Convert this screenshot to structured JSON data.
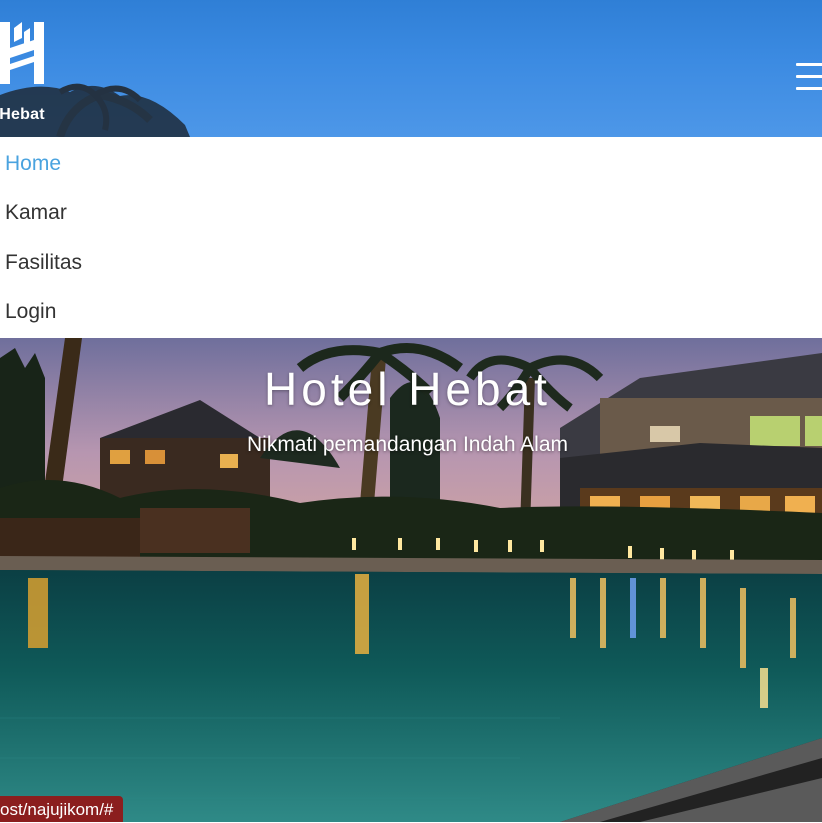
{
  "header": {
    "logo_text": "l Hebat",
    "logo_icon": "building-h-logo",
    "menu_icon": "hamburger-menu-icon"
  },
  "nav": {
    "items": [
      {
        "label": "Home",
        "active": true
      },
      {
        "label": "Kamar",
        "active": false
      },
      {
        "label": "Fasilitas",
        "active": false
      },
      {
        "label": "Login",
        "active": false
      }
    ]
  },
  "hero": {
    "title": "Hotel Hebat",
    "subtitle": "Nikmati pemandangan Indah Alam"
  },
  "status_bar": {
    "url": "ost/najujikom/#"
  },
  "colors": {
    "header_sky": "#3c8be2",
    "nav_active": "#4aa3df",
    "nav_text": "#333333",
    "status_bg": "#8b1e1e"
  }
}
